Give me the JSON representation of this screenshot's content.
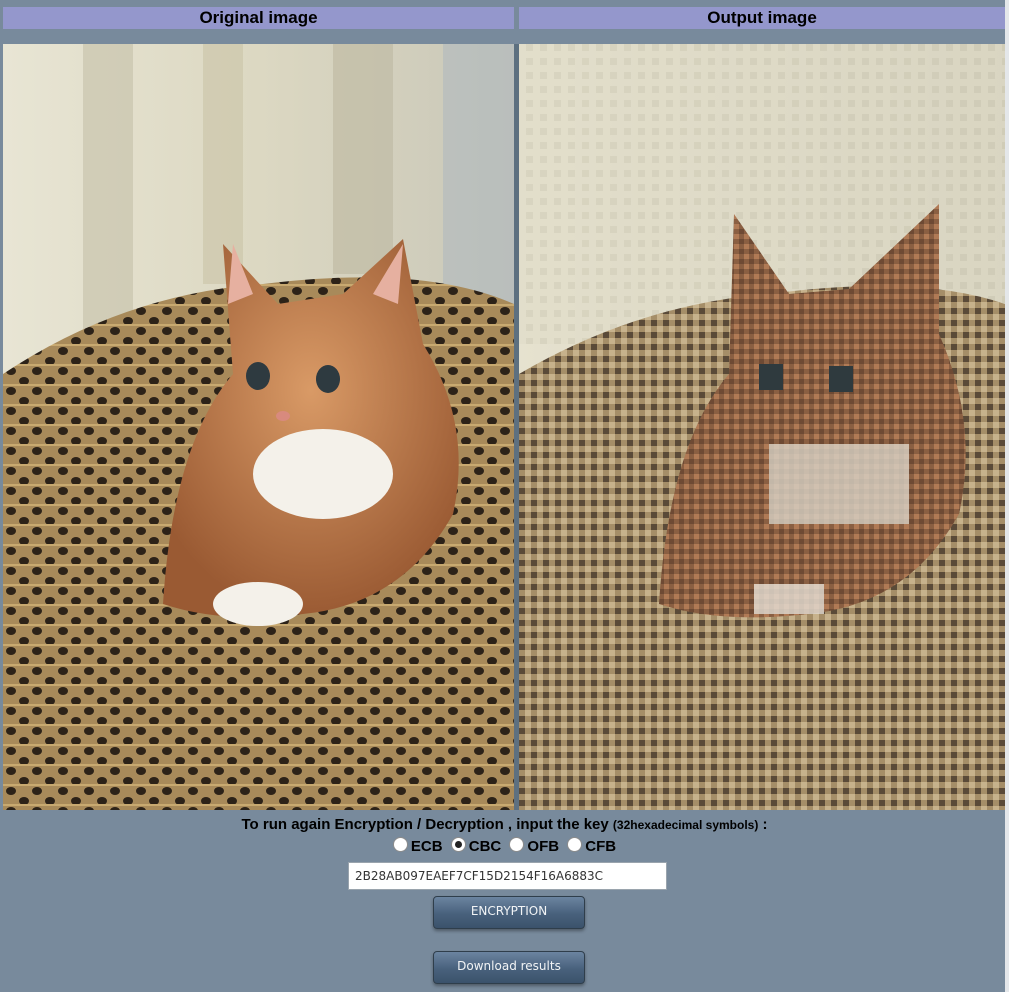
{
  "headers": {
    "original": "Original image",
    "output": "Output image"
  },
  "images": {
    "original": "photo of an orange and white kitten sitting in a woven straw hat",
    "output": "blocky encrypted rendition of the kitten photo"
  },
  "prompt": {
    "main": "To run again Encryption / Decryption , input the key",
    "note": "(32hexadecimal symbols)",
    "suffix": ":"
  },
  "modes": [
    {
      "label": "ECB",
      "selected": false
    },
    {
      "label": "CBC",
      "selected": true
    },
    {
      "label": "OFB",
      "selected": false
    },
    {
      "label": "CFB",
      "selected": false
    }
  ],
  "key": {
    "value": "2B28AB097EAEF7CF15D2154F16A6883C"
  },
  "buttons": {
    "encrypt": "ENCRYPTION",
    "download": "Download results"
  },
  "colors": {
    "background": "#788a9c",
    "header": "#9497cc",
    "button": "#48617c"
  }
}
